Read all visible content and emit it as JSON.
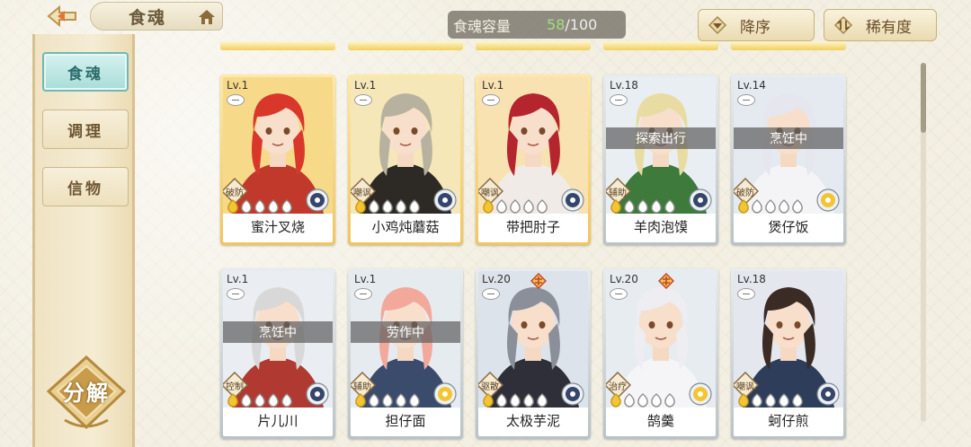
{
  "header": {
    "title": "食魂",
    "capacity_label": "食魂容量",
    "capacity_current": "58",
    "capacity_max": "/100",
    "sort_order_label": "降序",
    "sort_field_label": "稀有度"
  },
  "sidebar": {
    "items": [
      {
        "label": "食魂",
        "active": true
      },
      {
        "label": "调理",
        "active": false
      },
      {
        "label": "信物",
        "active": false
      }
    ],
    "decompose_label": "分解"
  },
  "colors": {
    "accent_teal": "#6fb8b4",
    "gold_frame": "#f3c55b",
    "silver_frame": "#b9c2c8",
    "capacity_green": "#9fe07a"
  },
  "cards": [
    {
      "level": "Lv.1",
      "name": "蜜汁叉烧",
      "role": "破防",
      "status": "",
      "max": false,
      "rarity": "gold",
      "hair": "#d9372a",
      "outfit": "#c0392b",
      "bg": "#f7d98a"
    },
    {
      "level": "Lv.1",
      "name": "小鸡炖蘑菇",
      "role": "嘲讽",
      "status": "",
      "max": false,
      "rarity": "gold",
      "hair": "#b7b29f",
      "outfit": "#2d2a26",
      "bg": "#f6e7b8"
    },
    {
      "level": "Lv.1",
      "name": "带把肘子",
      "role": "嘲讽",
      "status": "",
      "max": false,
      "rarity": "gold",
      "hair": "#b5252e",
      "outfit": "#f0ebe6",
      "bg": "#f8e2b2"
    },
    {
      "level": "Lv.18",
      "name": "羊肉泡馍",
      "role": "辅助",
      "status": "探索出行",
      "max": false,
      "rarity": "silver",
      "hair": "#e8dca2",
      "outfit": "#3d7a3c",
      "bg": "#e8eef2"
    },
    {
      "level": "Lv.14",
      "name": "煲仔饭",
      "role": "破防",
      "status": "烹饪中",
      "max": false,
      "rarity": "silver",
      "hair": "#e6e6ee",
      "outfit": "#f4f4f6",
      "bg": "#e4eaf0"
    },
    {
      "level": "Lv.1",
      "name": "片儿川",
      "role": "控制",
      "status": "烹饪中",
      "max": false,
      "rarity": "silver",
      "hair": "#d8d8d8",
      "outfit": "#b03a32",
      "bg": "#eaeef2"
    },
    {
      "level": "Lv.1",
      "name": "担仔面",
      "role": "辅助",
      "status": "劳作中",
      "max": false,
      "rarity": "silver",
      "hair": "#f2a89a",
      "outfit": "#3a4b6b",
      "bg": "#e6ebf0"
    },
    {
      "level": "Lv.20",
      "name": "太极芋泥",
      "role": "驱散",
      "status": "",
      "max": true,
      "rarity": "silver",
      "hair": "#8a8f99",
      "outfit": "#2e2f38",
      "bg": "#dde3ea"
    },
    {
      "level": "Lv.20",
      "name": "鹄羹",
      "role": "治疗",
      "status": "",
      "max": true,
      "rarity": "silver",
      "hair": "#eeeef2",
      "outfit": "#f5f5f8",
      "bg": "#e7ecf1"
    },
    {
      "level": "Lv.18",
      "name": "蚵仔煎",
      "role": "嘲讽",
      "status": "",
      "max": false,
      "rarity": "silver",
      "hair": "#3b2b25",
      "outfit": "#2d3d5a",
      "bg": "#e4e8ee"
    }
  ]
}
